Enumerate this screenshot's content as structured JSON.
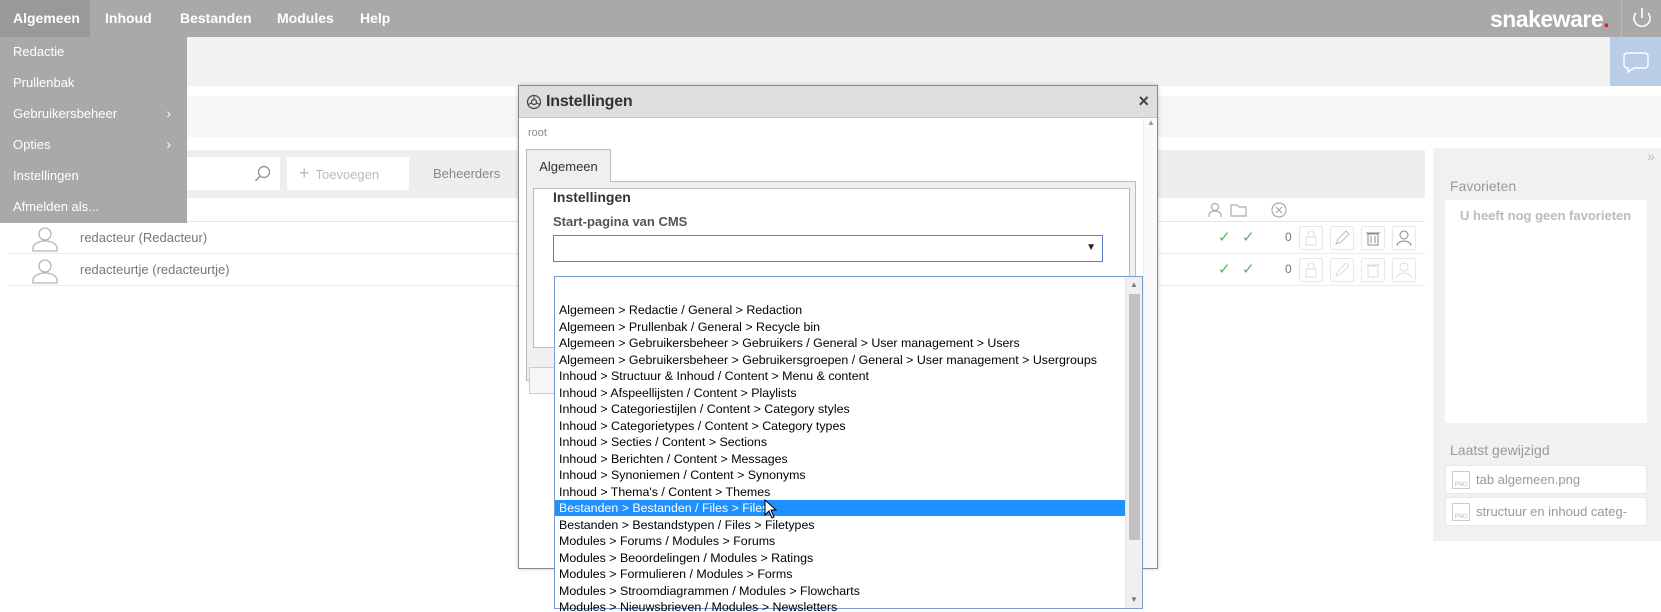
{
  "topbar": {
    "nav": [
      "Algemeen",
      "Inhoud",
      "Bestanden",
      "Modules",
      "Help"
    ],
    "brand": "snakeware",
    "brand_dot": "."
  },
  "menu": {
    "items": [
      {
        "label": "Redactie"
      },
      {
        "label": "Prullenbak"
      },
      {
        "label": "Gebruikersbeheer",
        "chevron": "›"
      },
      {
        "label": "Opties",
        "chevron": "›"
      },
      {
        "label": "Instellingen"
      },
      {
        "label": "Afmelden als..."
      }
    ]
  },
  "toolbar": {
    "add_label": "Toevoegen",
    "add_plus": "+",
    "group_label": "Beheerders"
  },
  "users": [
    {
      "name": "redacteur (Redacteur)",
      "count": "0"
    },
    {
      "name": "redacteurtje (redacteurtje)",
      "count": "0"
    }
  ],
  "check": "✓",
  "right_panel": {
    "collapse_glyph": "»",
    "favorites_title": "Favorieten",
    "favorites_empty": "U heeft nog geen favorieten",
    "recent_title": "Laatst gewijzigd",
    "recent_files": [
      "tab algemeen.png",
      "structuur en inhoud categ-"
    ],
    "file_badge": "PNG"
  },
  "modal": {
    "title": "Instellingen",
    "close": "×",
    "breadcrumb": "root",
    "tab": "Algemeen",
    "section_title": "Instellingen",
    "field_label": "Start-pagina van CMS",
    "select_value": "",
    "select_arrow": "▼"
  },
  "listbox": {
    "selected_index": 12,
    "up": "▲",
    "down": "▼",
    "options": [
      "Algemeen > Redactie / General > Redaction",
      "Algemeen > Prullenbak / General > Recycle bin",
      "Algemeen > Gebruikersbeheer > Gebruikers / General > User management > Users",
      "Algemeen > Gebruikersbeheer > Gebruikersgroepen / General > User management > Usergroups",
      "Inhoud > Structuur & Inhoud / Content > Menu & content",
      "Inhoud > Afspeellijsten / Content > Playlists",
      "Inhoud > Categoriestijlen / Content > Category styles",
      "Inhoud > Categorietypes / Content > Category types",
      "Inhoud > Secties / Content > Sections",
      "Inhoud > Berichten / Content > Messages",
      "Inhoud > Synoniemen / Content > Synonyms",
      "Inhoud > Thema's / Content > Themes",
      "Bestanden > Bestanden / Files > Files",
      "Bestanden > Bestandstypen / Files > Filetypes",
      "Modules > Forums / Modules > Forums",
      "Modules > Beoordelingen / Modules > Ratings",
      "Modules > Formulieren / Modules > Forms",
      "Modules > Stroomdiagrammen / Modules > Flowcharts",
      "Modules > Nieuwsbrieven / Modules > Newsletters"
    ]
  }
}
